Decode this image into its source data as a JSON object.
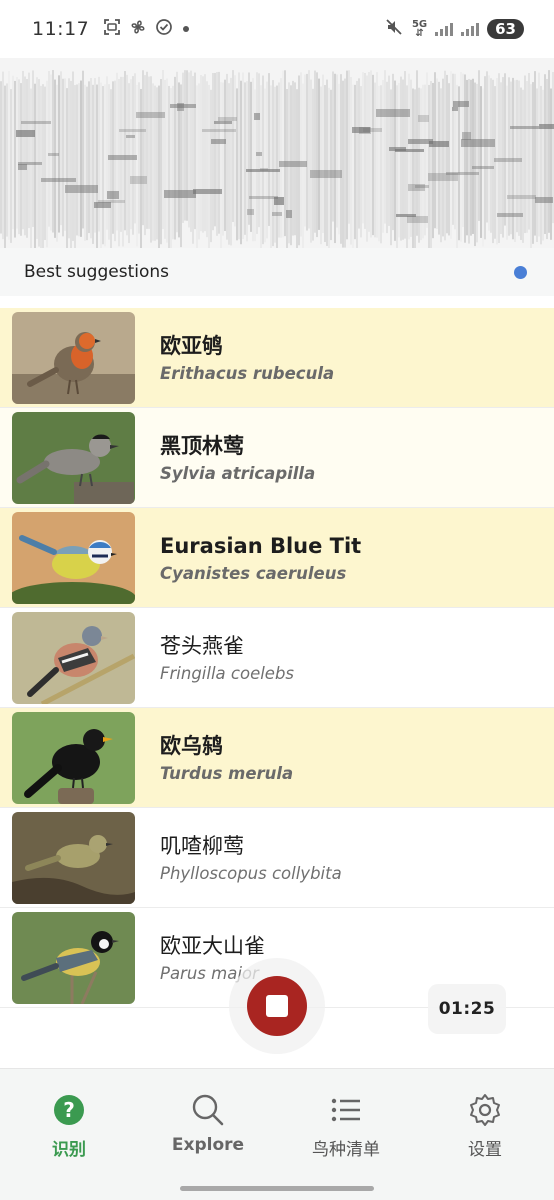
{
  "status_bar": {
    "time": "11:17",
    "network": "5G",
    "battery": "63"
  },
  "suggestions": {
    "title": "Best suggestions",
    "dot_color": "#4a7fd6"
  },
  "species": [
    {
      "common": "欧亚鸲",
      "scientific": "Erithacus rubecula",
      "highlight": "strong",
      "bold": true
    },
    {
      "common": "黑顶林莺",
      "scientific": "Sylvia atricapilla",
      "highlight": "light",
      "bold": true
    },
    {
      "common": "Eurasian Blue Tit",
      "scientific": "Cyanistes caeruleus",
      "highlight": "strong",
      "bold": true
    },
    {
      "common": "苍头燕雀",
      "scientific": "Fringilla coelebs",
      "highlight": "none",
      "bold": false
    },
    {
      "common": "欧乌鸫",
      "scientific": "Turdus merula",
      "highlight": "strong",
      "bold": true
    },
    {
      "common": "叽喳柳莺",
      "scientific": "Phylloscopus collybita",
      "highlight": "none",
      "bold": false
    },
    {
      "common": "欧亚大山雀",
      "scientific": "Parus major",
      "highlight": "none",
      "bold": false
    }
  ],
  "recording": {
    "timer": "01:25",
    "button_color": "#a92521"
  },
  "nav": {
    "items": [
      {
        "label": "识别",
        "icon": "question-circle-icon",
        "active": true
      },
      {
        "label": "Explore",
        "icon": "search-icon",
        "active": false
      },
      {
        "label": "鸟种清单",
        "icon": "list-icon",
        "active": false
      },
      {
        "label": "设置",
        "icon": "gear-icon",
        "active": false
      }
    ],
    "active_color": "#3b9a50"
  }
}
